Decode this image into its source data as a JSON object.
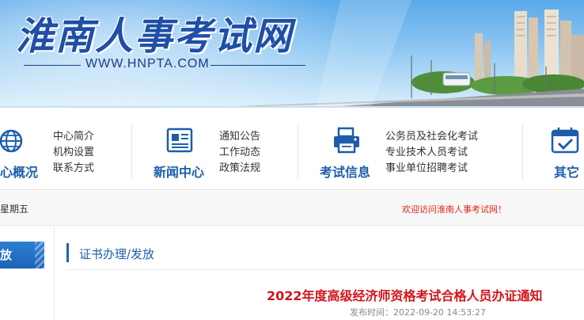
{
  "header": {
    "site_title": "淮南人事考试网",
    "site_url": "WWW.HNPTA.COM"
  },
  "nav": [
    {
      "title": "心概况",
      "icon": "globe-icon",
      "links": [
        "中心简介",
        "机构设置",
        "联系方式"
      ]
    },
    {
      "title": "新闻中心",
      "icon": "newspaper-icon",
      "links": [
        "通知公告",
        "工作动态",
        "政策法规"
      ]
    },
    {
      "title": "考试信息",
      "icon": "printer-icon",
      "links": [
        "公务员及社会化考试",
        "专业技术人员考试",
        "事业单位招聘考试"
      ]
    },
    {
      "title": "其它",
      "icon": "calendar-check-icon",
      "links": []
    }
  ],
  "info_strip": {
    "date_text": "星期五",
    "welcome_text": "欢迎访问淮南人事考试网！"
  },
  "sidebar": {
    "active_tab_label": "放"
  },
  "content": {
    "breadcrumb": "证书办理/发放",
    "article_title": "2022年度高级经济师资格考试合格人员办证通知",
    "publish_time": "发布时间：2022-09-20 14:53:27"
  },
  "colors": {
    "brand_blue": "#1d5eab",
    "title_red": "#d3141a",
    "welcome_red": "#e0251b"
  }
}
